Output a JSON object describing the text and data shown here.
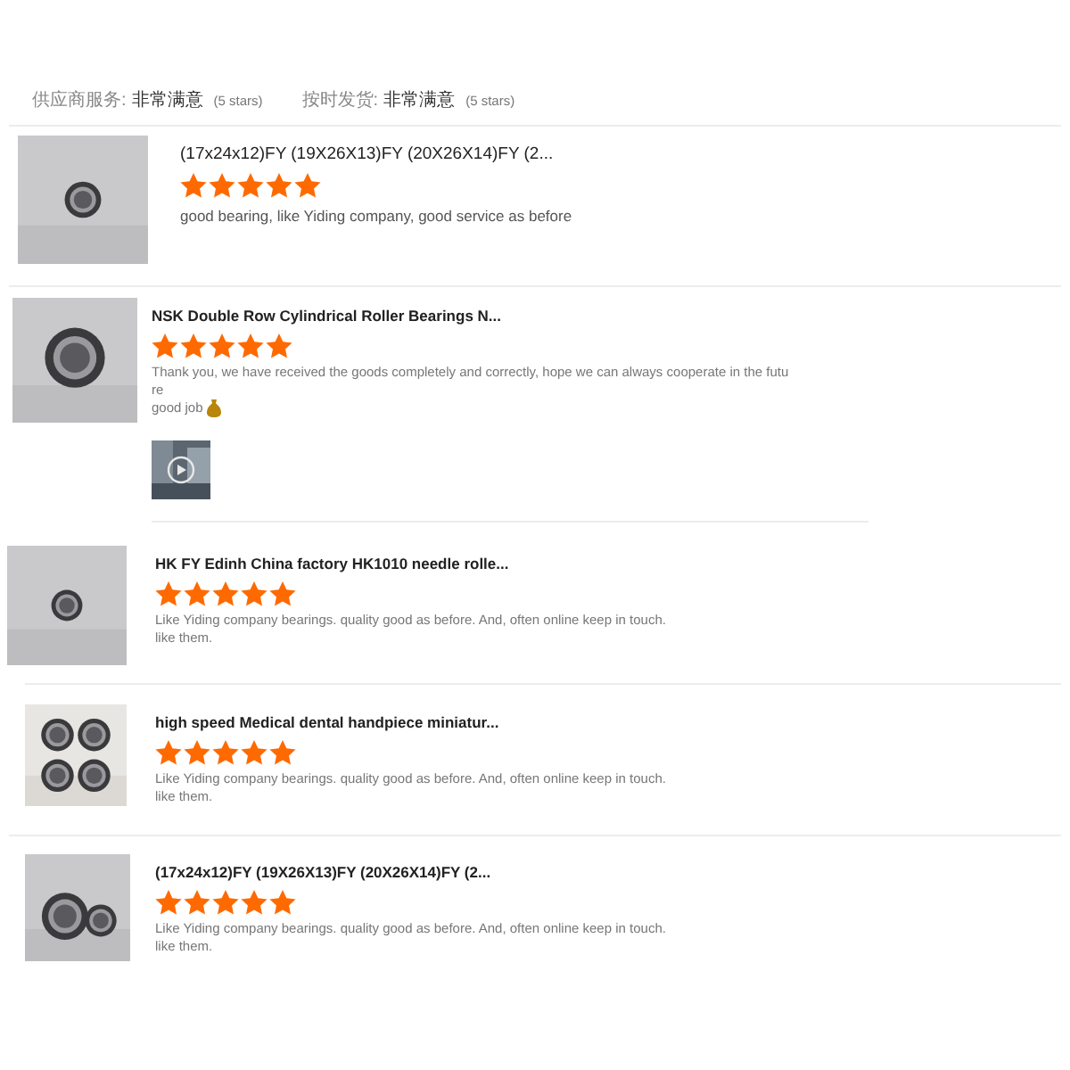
{
  "ratings": [
    {
      "label": "供应商服务:",
      "value": "非常满意",
      "note": "(5 stars)"
    },
    {
      "label": "按时发货:",
      "value": "非常满意",
      "note": "(5 stars)"
    }
  ],
  "reviews": [
    {
      "title": "(17x24x12)FY (19X26X13)FY (20X26X14)FY (2...",
      "stars": 5,
      "comment": [
        "good bearing, like Yiding company, good service as before"
      ],
      "photo": {
        "kind": "picture"
      }
    },
    {
      "title": "NSK Double Row Cylindrical Roller Bearings N...",
      "stars": 5,
      "comment": [
        "Thank you, we have received the goods completely and correctly, hope we can always cooperate in the futu",
        "re",
        "good job"
      ],
      "photo": {
        "kind": "picture"
      },
      "video": {
        "kind": "picture"
      }
    },
    {
      "title": "HK FY Edinh China factory HK1010 needle rolle...",
      "stars": 5,
      "comment": [
        "Like Yiding company bearings. quality good as before. And, often online keep in touch.",
        "like them."
      ],
      "photo": {
        "kind": "picture"
      }
    },
    {
      "title": "high speed Medical dental handpiece miniatur...",
      "stars": 5,
      "comment": [
        "Like Yiding company bearings. quality good as before. And, often online keep in touch.",
        "like them."
      ],
      "photo": {
        "kind": "picture"
      }
    },
    {
      "title": "(17x24x12)FY (19X26X13)FY (20X26X14)FY (2...",
      "stars": 5,
      "comment": [
        "Like Yiding company bearings. quality good as before. And, often online keep in touch.",
        "like them."
      ],
      "photo": {
        "kind": "picture"
      }
    }
  ]
}
